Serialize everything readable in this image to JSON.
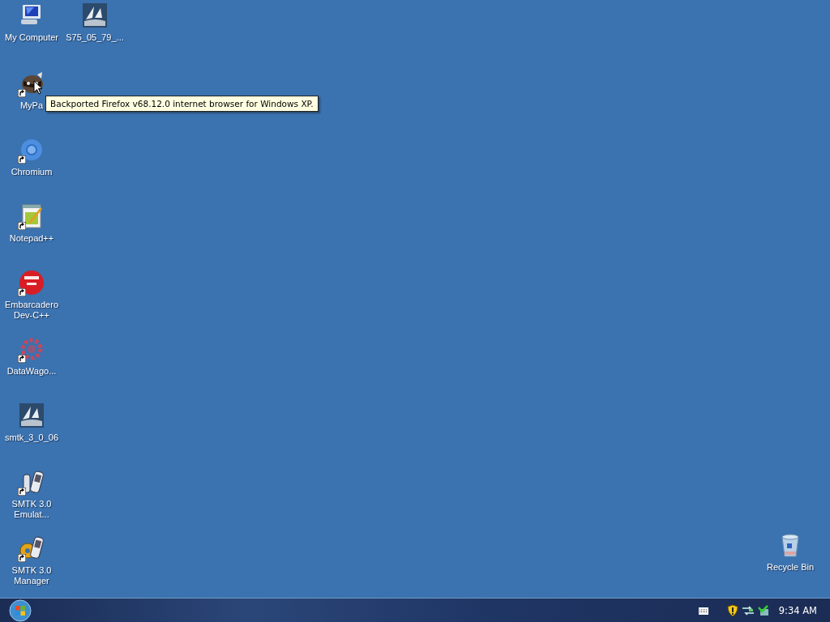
{
  "desktop_icons": [
    {
      "label": "My Computer",
      "kind": "computer",
      "shortcut": false
    },
    {
      "label": "S75_05_79_...",
      "kind": "sail",
      "shortcut": false
    },
    {
      "label": "MyPa",
      "kind": "raccoon",
      "shortcut": true
    },
    {
      "label": "Chromium",
      "kind": "chromium",
      "shortcut": true
    },
    {
      "label": "Notepad++",
      "kind": "notepad",
      "shortcut": true
    },
    {
      "label": "Embarcadero Dev-C++",
      "kind": "dev",
      "shortcut": true
    },
    {
      "label": "DataWago...",
      "kind": "gear",
      "shortcut": true
    },
    {
      "label": "smtk_3_0_06",
      "kind": "sail",
      "shortcut": false
    },
    {
      "label": "SMTK 3.0 Emulat...",
      "kind": "phones",
      "shortcut": true
    },
    {
      "label": "SMTK 3.0 Manager",
      "kind": "phonegear",
      "shortcut": true
    },
    {
      "label": "Recycle Bin",
      "kind": "bin",
      "shortcut": false
    }
  ],
  "tooltip": {
    "text": "Backported Firefox v68.12.0 internet browser for Windows XP."
  },
  "taskbar": {
    "clock": "9:34 AM"
  }
}
